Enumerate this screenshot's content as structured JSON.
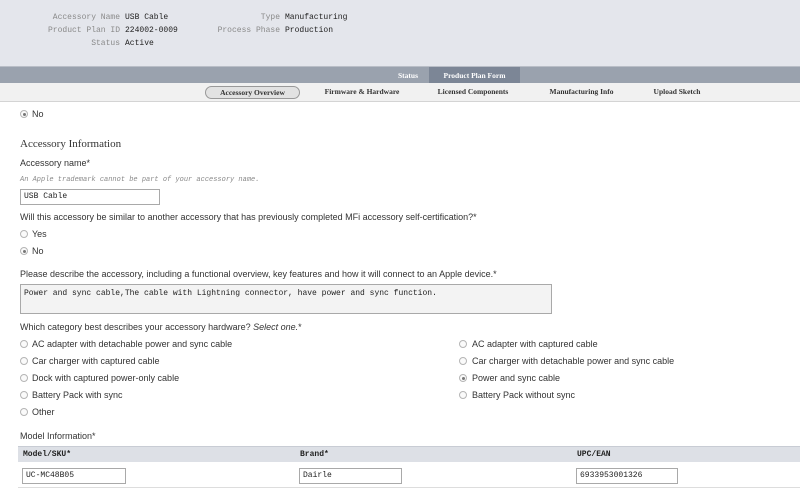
{
  "header": {
    "accessory_name_label": "Accessory Name",
    "accessory_name_value": "USB Cable",
    "plan_id_label": "Product Plan ID",
    "plan_id_value": "224002-0009",
    "status_label": "Status",
    "status_value": "Active",
    "type_label": "Type",
    "type_value": "Manufacturing",
    "phase_label": "Process Phase",
    "phase_value": "Production"
  },
  "top_tabs": [
    {
      "label": "Status"
    },
    {
      "label": "Product Plan Form",
      "active": true
    }
  ],
  "sub_tabs": [
    {
      "label": "Accessory Overview",
      "active": true
    },
    {
      "label": "Firmware & Hardware"
    },
    {
      "label": "Licensed Components"
    },
    {
      "label": "Manufacturing Info"
    },
    {
      "label": "Upload Sketch"
    }
  ],
  "form": {
    "top_radio_no": "No",
    "section_title": "Accessory Information",
    "accessory_name_label": "Accessory name*",
    "accessory_name_hint": "An Apple trademark cannot be part of your accessory name.",
    "accessory_name_value": "USB Cable",
    "similar_question": "Will this accessory be similar to another accessory that has previously completed MFi accessory self-certification?*",
    "similar_yes": "Yes",
    "similar_no": "No",
    "describe_question": "Please describe the accessory, including a functional overview, key features and how it will connect to an Apple device.*",
    "describe_value": "Power and sync cable,The cable with Lightning connector, have power and sync function.",
    "category_question": "Which category best describes your accessory hardware?",
    "category_hint": "Select one.",
    "category_star": "*",
    "categories_left": [
      "AC adapter with detachable power and sync cable",
      "Car charger with captured cable",
      "Dock with captured power-only cable",
      "Battery Pack with sync",
      "Other"
    ],
    "categories_right": [
      "AC adapter with captured cable",
      "Car charger with detachable power and sync cable",
      "Power and sync cable",
      "Battery Pack without sync"
    ],
    "selected_category": "Power and sync cable",
    "model_info_label": "Model Information*",
    "model_headers": [
      "Model/SKU*",
      "Brand*",
      "UPC/EAN"
    ],
    "model_row": {
      "sku": "UC-MC48B05",
      "brand": "Dairle",
      "upc": "6933953001326"
    }
  }
}
